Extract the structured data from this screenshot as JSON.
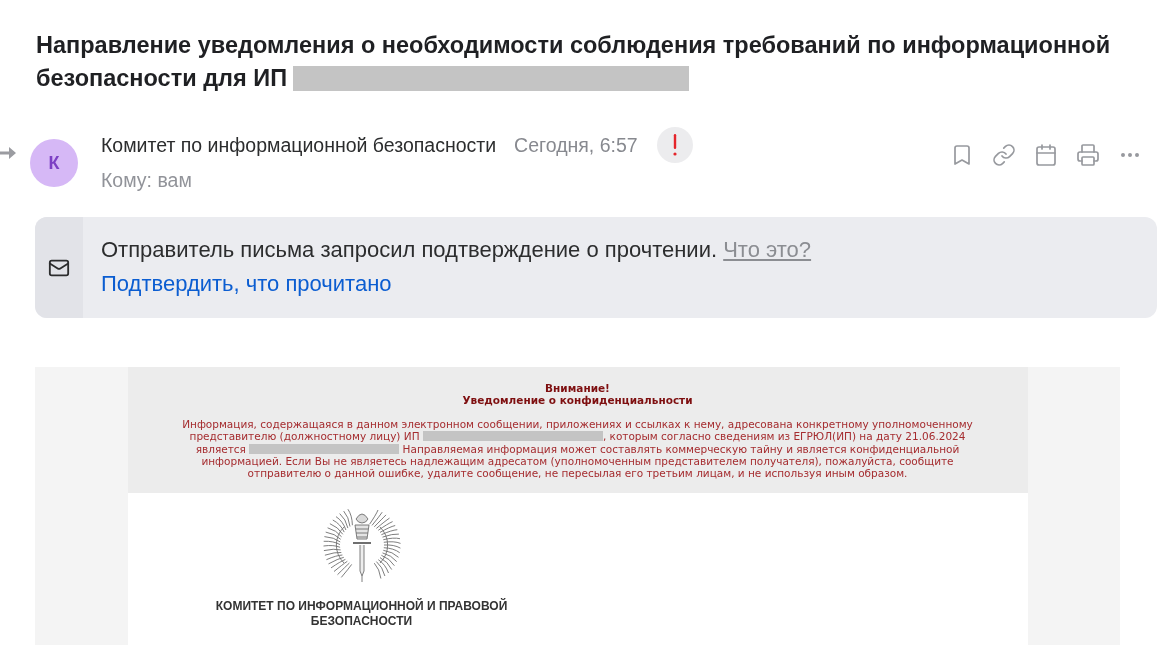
{
  "email": {
    "subject": [
      {
        "kind": "text",
        "text": "Направление уведомления о необходимости соблюдения требований по информационной безопасности для ИП"
      },
      {
        "kind": "redaction"
      }
    ],
    "sender": {
      "avatar_letter": "К",
      "name": "Комитет по информационной безопасности",
      "time": "Сегодня, 6:57",
      "important": true,
      "recipient": "Кому: вам"
    },
    "read_receipt": {
      "message": "Отправитель письма запросил подтверждение о прочтении.",
      "help_link": "Что это?",
      "confirm_link": "Подтвердить, что прочитано"
    },
    "body": {
      "notice": {
        "heading": "Внимание!",
        "subheading": "Уведомление о конфиденциальности",
        "paragraph": [
          {
            "kind": "text",
            "text": "Информация, содержащаяся в данном электронном сообщении, приложениях и ссылках к нему, адресована конкретному уполномоченному представителю (должностному лицу) ИП "
          },
          {
            "kind": "redaction"
          },
          {
            "kind": "text",
            "text": ", которым согласно сведениям из ЕГРЮЛ(ИП) на дату 21.06.2024 является "
          },
          {
            "kind": "redaction"
          },
          {
            "kind": "text",
            "text": " Направляемая информация может составлять коммерческую тайну и является конфиденциальной информацией. Если Вы не являетесь надлежащим адресатом (уполномоченным представителем получателя), пожалуйста, сообщите отправителю о данной ошибке, удалите сообщение, не пересылая его третьим лицам, и не используя иным образом."
          }
        ]
      },
      "organization": "КОМИТЕТ ПО ИНФОРМАЦИОННОЙ И ПРАВОВОЙ БЕЗОПАСНОСТИ"
    }
  }
}
